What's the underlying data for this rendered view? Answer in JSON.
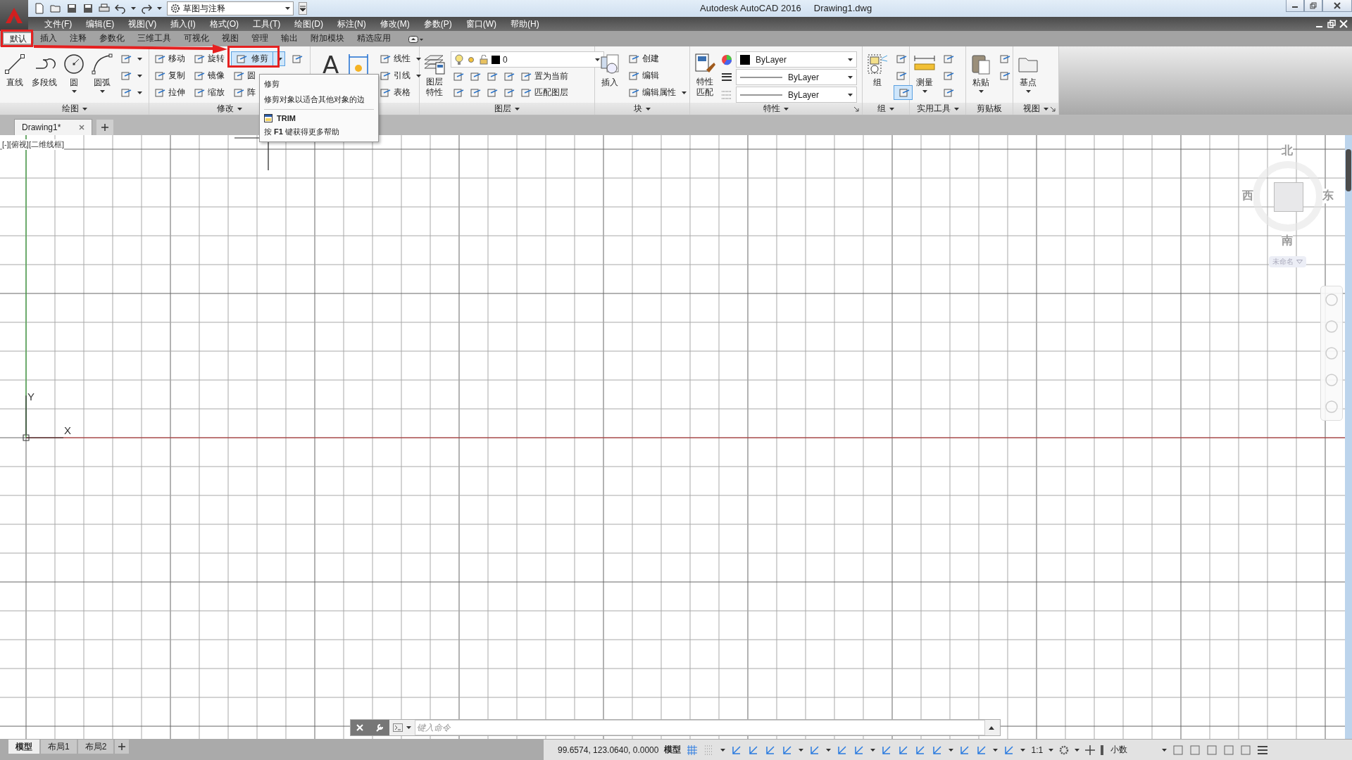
{
  "title_bar": {
    "workspace": "草图与注释",
    "app_title": "Autodesk AutoCAD 2016",
    "file_name": "Drawing1.dwg"
  },
  "menu_bar": [
    "文件(F)",
    "编辑(E)",
    "视图(V)",
    "插入(I)",
    "格式(O)",
    "工具(T)",
    "绘图(D)",
    "标注(N)",
    "修改(M)",
    "参数(P)",
    "窗口(W)",
    "帮助(H)"
  ],
  "ribbon_tabs": [
    {
      "label": "默认",
      "selected": true
    },
    {
      "label": "插入",
      "selected": false
    },
    {
      "label": "注释",
      "selected": false
    },
    {
      "label": "参数化",
      "selected": false
    },
    {
      "label": "三维工具",
      "selected": false
    },
    {
      "label": "可视化",
      "selected": false
    },
    {
      "label": "视图",
      "selected": false
    },
    {
      "label": "管理",
      "selected": false
    },
    {
      "label": "输出",
      "selected": false
    },
    {
      "label": "附加模块",
      "selected": false
    },
    {
      "label": "精选应用",
      "selected": false
    }
  ],
  "ribbon_panels": [
    {
      "title": "绘图",
      "title_dropdown": true,
      "launcher": false,
      "columns": [
        {
          "kind": "large",
          "label": "直线",
          "dropdown": false
        },
        {
          "kind": "large",
          "label": "多段线",
          "dropdown": false
        },
        {
          "kind": "large",
          "label": "圆",
          "dropdown": true
        },
        {
          "kind": "large",
          "label": "圆弧",
          "dropdown": true
        },
        {
          "kind": "small",
          "rows": [
            {
              "dropdown": true,
              "highlighted": false
            },
            {
              "dropdown": true,
              "highlighted": false
            },
            {
              "dropdown": true,
              "highlighted": false
            }
          ]
        }
      ]
    },
    {
      "title": "修改",
      "title_dropdown": true,
      "launcher": false,
      "columns": [
        {
          "kind": "small",
          "rows": [
            {
              "label": "移动",
              "dropdown": false,
              "highlighted": false
            },
            {
              "label": "复制",
              "dropdown": false,
              "highlighted": false
            },
            {
              "label": "拉伸",
              "dropdown": false,
              "highlighted": false
            }
          ]
        },
        {
          "kind": "small",
          "rows": [
            {
              "label": "旋转",
              "dropdown": false,
              "highlighted": false
            },
            {
              "label": "镜像",
              "dropdown": false,
              "highlighted": false
            },
            {
              "label": "缩放",
              "dropdown": false,
              "highlighted": false
            }
          ]
        },
        {
          "kind": "small",
          "rows": [
            {
              "label": "修剪",
              "dropdown": true,
              "highlighted": true
            },
            {
              "label": "圆",
              "dropdown": false,
              "highlighted": false
            },
            {
              "label": "阵",
              "dropdown": false,
              "highlighted": false
            }
          ]
        },
        {
          "kind": "small",
          "rows": [
            {
              "dropdown": false,
              "highlighted": false
            }
          ]
        }
      ]
    },
    {
      "title_dropdown": false,
      "launcher": false,
      "columns": [
        {
          "kind": "large",
          "glyph": "A",
          "dropdown": false
        },
        {
          "kind": "large",
          "dropdown": false
        },
        {
          "kind": "small",
          "rows": [
            {
              "label": "线性",
              "dropdown": true,
              "highlighted": false
            },
            {
              "label": "引线",
              "dropdown": true,
              "highlighted": false
            },
            {
              "label": "表格",
              "dropdown": false,
              "highlighted": false
            }
          ]
        }
      ]
    },
    {
      "title": "图层",
      "title_dropdown": true,
      "launcher": false,
      "columns": [
        {
          "kind": "large",
          "label": "图层特性",
          "dropdown": false
        },
        {
          "kind": "layers",
          "current_layer": "0",
          "rows": [
            {
              "label": "置为当前"
            },
            {
              "label": "匹配图层"
            }
          ]
        }
      ]
    },
    {
      "title": "块",
      "title_dropdown": true,
      "launcher": false,
      "columns": [
        {
          "kind": "large",
          "label": "插入",
          "dropdown": false
        },
        {
          "kind": "small",
          "rows": [
            {
              "label": "创建",
              "dropdown": false,
              "highlighted": false
            },
            {
              "label": "编辑",
              "dropdown": false,
              "highlighted": false
            },
            {
              "label": "编辑属性",
              "dropdown": true,
              "highlighted": false
            }
          ]
        }
      ]
    },
    {
      "title": "特性",
      "title_dropdown": true,
      "launcher": true,
      "columns": [
        {
          "kind": "large",
          "label": "特性匹配",
          "dropdown": false
        },
        {
          "kind": "props",
          "selects": [
            {
              "kind": "color",
              "value": "ByLayer"
            },
            {
              "kind": "linetype",
              "value": "ByLayer"
            },
            {
              "kind": "lineweight",
              "value": "ByLayer"
            }
          ]
        }
      ]
    },
    {
      "title": "组",
      "title_dropdown": true,
      "launcher": false,
      "columns": [
        {
          "kind": "large",
          "label": "组",
          "dropdown": false
        },
        {
          "kind": "small",
          "rows": [
            {
              "dropdown": false,
              "highlighted": false
            },
            {
              "dropdown": false,
              "highlighted": false
            },
            {
              "dropdown": false,
              "highlighted": true
            }
          ]
        }
      ]
    },
    {
      "title": "实用工具",
      "title_dropdown": true,
      "launcher": false,
      "columns": [
        {
          "kind": "large",
          "label": "测量",
          "dropdown": true
        },
        {
          "kind": "small",
          "rows": [
            {
              "dropdown": false,
              "highlighted": false
            },
            {
              "dropdown": false,
              "highlighted": false
            },
            {
              "dropdown": false,
              "highlighted": false
            }
          ]
        }
      ]
    },
    {
      "title": "剪贴板",
      "title_dropdown": false,
      "launcher": false,
      "columns": [
        {
          "kind": "large",
          "label": "粘贴",
          "dropdown": true
        },
        {
          "kind": "small",
          "rows": [
            {
              "dropdown": false,
              "highlighted": false
            },
            {
              "dropdown": false,
              "highlighted": false
            }
          ]
        }
      ]
    },
    {
      "title": "视图",
      "title_dropdown": true,
      "launcher": true,
      "columns": [
        {
          "kind": "large",
          "label": "基点",
          "dropdown": true
        }
      ]
    }
  ],
  "tooltip": {
    "title": "修剪",
    "description": "修剪对象以适合其他对象的边",
    "command": "TRIM",
    "help": "按 **F1** 键获得更多帮助"
  },
  "doc_tabs": [
    {
      "label": "Drawing1*",
      "selected": true
    }
  ],
  "viewport_label": "[-][俯视][二维线框]",
  "viewcube": {
    "north": "北",
    "south": "南",
    "east": "东",
    "west": "西",
    "view_name": "未命名"
  },
  "axes": {
    "x": "X",
    "y": "Y"
  },
  "command_line": {
    "placeholder": "键入命令"
  },
  "layout_tabs": [
    {
      "label": "模型",
      "selected": true
    },
    {
      "label": "布局1",
      "selected": false
    },
    {
      "label": "布局2",
      "selected": false
    }
  ],
  "status_bar": {
    "coordinates": "99.6574, 123.0640, 0.0000",
    "space": "模型",
    "annotation_scale": "1:1",
    "units": "小数"
  }
}
